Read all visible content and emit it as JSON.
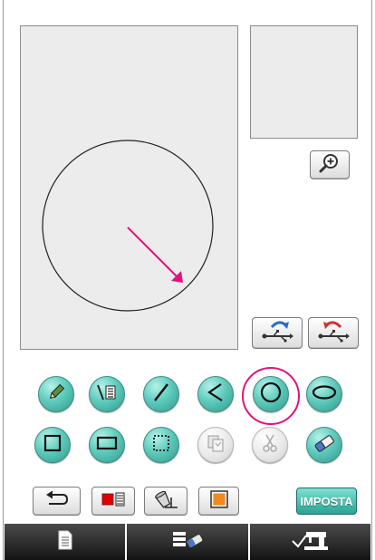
{
  "screen": {
    "canvas": {
      "tool_shape": "circle"
    },
    "preview": {},
    "buttons": {
      "zoom": {
        "icon": "zoom-in-icon"
      },
      "save_to_usb": {
        "icon": "usb-save-icon"
      },
      "load_from_usb": {
        "icon": "usb-load-icon"
      }
    },
    "tools": [
      {
        "icon": "pencil-icon",
        "enabled": true
      },
      {
        "icon": "line-style-icon",
        "enabled": true
      },
      {
        "icon": "straight-line-icon",
        "enabled": true
      },
      {
        "icon": "polyline-icon",
        "enabled": true
      },
      {
        "icon": "circle-icon",
        "enabled": true,
        "selected": true
      },
      {
        "icon": "ellipse-icon",
        "enabled": true
      },
      {
        "icon": "square-icon",
        "enabled": true
      },
      {
        "icon": "rectangle-icon",
        "enabled": true
      },
      {
        "icon": "selection-icon",
        "enabled": true
      },
      {
        "icon": "paste-icon",
        "enabled": false
      },
      {
        "icon": "scissors-icon",
        "enabled": false
      },
      {
        "icon": "eraser-icon",
        "enabled": true
      }
    ],
    "bottom_row": {
      "undo": {
        "icon": "undo-icon"
      },
      "line_color": {
        "icon": "line-color-icon",
        "color": "#e00000"
      },
      "fill": {
        "icon": "paint-bucket-icon"
      },
      "region_color": {
        "icon": "region-color-icon",
        "color": "#f08a1e"
      },
      "set_label": "IMPOSTA"
    },
    "tabs": [
      {
        "icon": "document-icon"
      },
      {
        "icon": "stitch-settings-icon"
      },
      {
        "icon": "embroidery-machine-icon"
      }
    ],
    "colors": {
      "accent": "#e2137a",
      "teal": "#3fb9aa",
      "tab_bg": "#1a1a1a"
    }
  }
}
